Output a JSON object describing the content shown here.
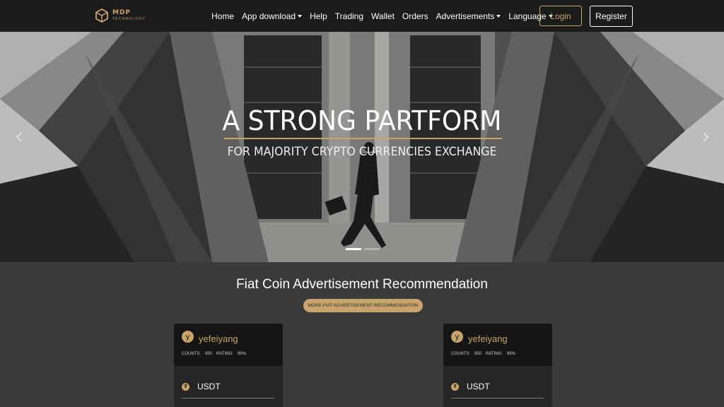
{
  "brand": {
    "logo_main": "MDP",
    "logo_sub": "TECHNOLOGY"
  },
  "nav": {
    "items": [
      {
        "label": "Home",
        "dropdown": false
      },
      {
        "label": "App download",
        "dropdown": true
      },
      {
        "label": "Help",
        "dropdown": false
      },
      {
        "label": "Trading",
        "dropdown": false
      },
      {
        "label": "Wallet",
        "dropdown": false
      },
      {
        "label": "Orders",
        "dropdown": false
      },
      {
        "label": "Advertisements",
        "dropdown": true
      },
      {
        "label": "Language",
        "dropdown": true
      }
    ],
    "login": "Login",
    "register": "Register"
  },
  "hero": {
    "title": "A STRONG PARTFORM",
    "subtitle": "FOR MAJORITY CRYPTO CURRENCIES EXCHANGE",
    "prev_icon": "chevron-left-icon",
    "next_icon": "chevron-right-icon",
    "slides": 2,
    "active_slide": 1
  },
  "section": {
    "title": "Fiat Coin Advertisement Recommendation",
    "more_button": "MORE FIAT ADVERTISEMENT RECOMMENDATION"
  },
  "cards": [
    {
      "avatar": "y",
      "username": "yefeiyang",
      "counts_label": "COUNTS:",
      "counts": "950",
      "rating_label": "RATING:",
      "rating": "99%",
      "coin_icon": "₮",
      "coin": "USDT"
    },
    {
      "avatar": "y",
      "username": "yefeiyang",
      "counts_label": "COUNTS:",
      "counts": "950",
      "rating_label": "RATING:",
      "rating": "99%",
      "coin_icon": "₮",
      "coin": "USDT"
    }
  ],
  "colors": {
    "accent": "#c9a46a",
    "nav_bg": "#1b1b1b",
    "page_bg": "#3a3a3a",
    "card_bg": "#262626"
  }
}
